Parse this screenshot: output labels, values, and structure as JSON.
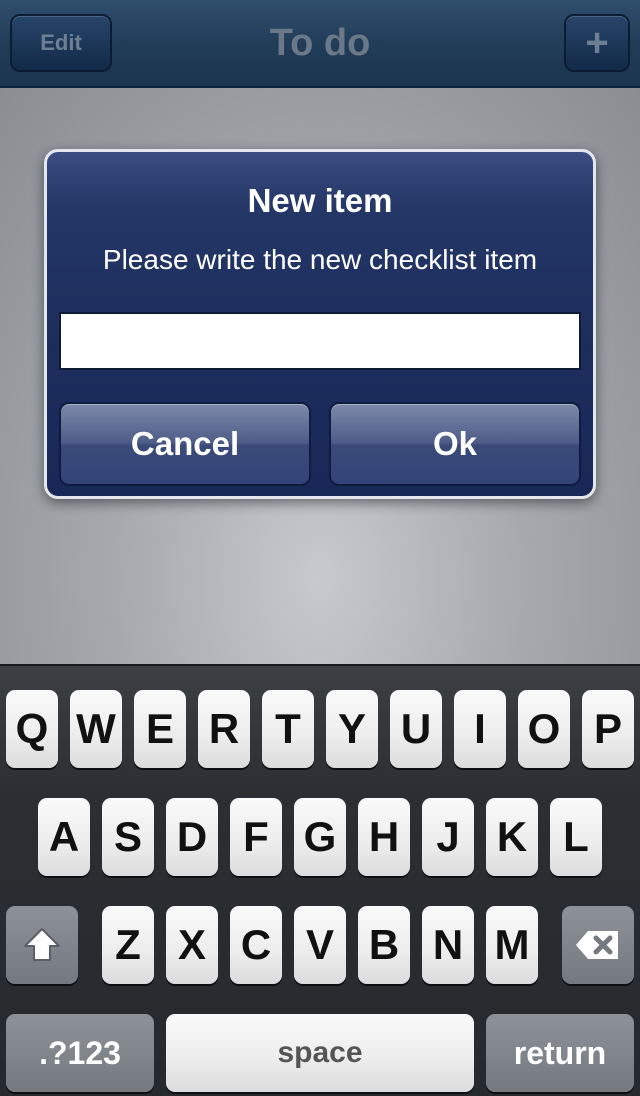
{
  "navbar": {
    "title": "To do",
    "edit_label": "Edit",
    "add_label": "+"
  },
  "alert": {
    "title": "New item",
    "message": "Please write the new checklist item",
    "input_value": "",
    "input_placeholder": "",
    "cancel_label": "Cancel",
    "ok_label": "Ok"
  },
  "keyboard": {
    "row1": [
      "Q",
      "W",
      "E",
      "R",
      "T",
      "Y",
      "U",
      "I",
      "O",
      "P"
    ],
    "row2": [
      "A",
      "S",
      "D",
      "F",
      "G",
      "H",
      "J",
      "K",
      "L"
    ],
    "row3": [
      "Z",
      "X",
      "C",
      "V",
      "B",
      "N",
      "M"
    ],
    "shift_icon": "shift-icon",
    "delete_icon": "delete-icon",
    "numbers_label": ".?123",
    "space_label": "space",
    "return_label": "return"
  },
  "colors": {
    "navbar": "#223d59",
    "alert": "#1c2c5c",
    "keyboard": "#2b2e32"
  }
}
